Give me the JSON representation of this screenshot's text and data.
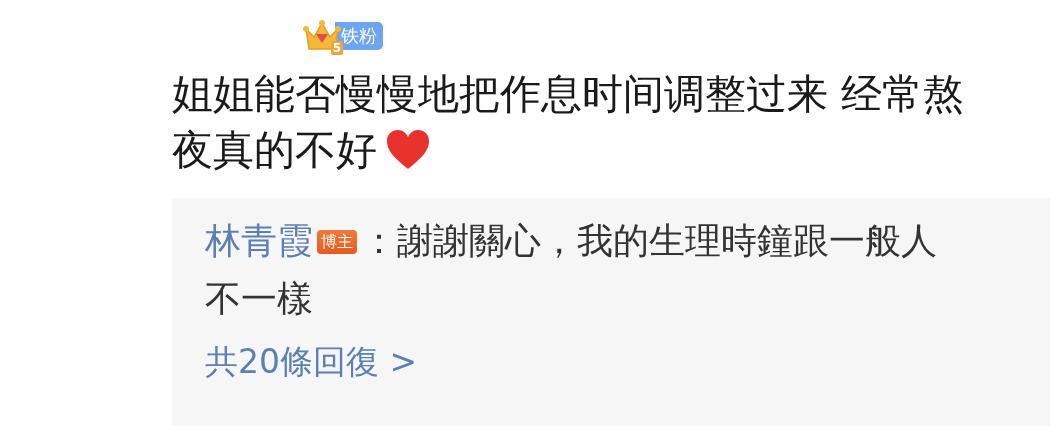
{
  "fan_badge": {
    "level": "5",
    "label": "铁粉"
  },
  "comment": {
    "lines": [
      "姐姐能否慢慢地把作息时间调整过来 经常熬",
      "夜真的不好"
    ]
  },
  "reply": {
    "author": "林青霞",
    "author_badge": "博主",
    "text": "：謝謝關心，我的生理時鐘跟一般人不一樣",
    "more": "共20條回復 >"
  }
}
